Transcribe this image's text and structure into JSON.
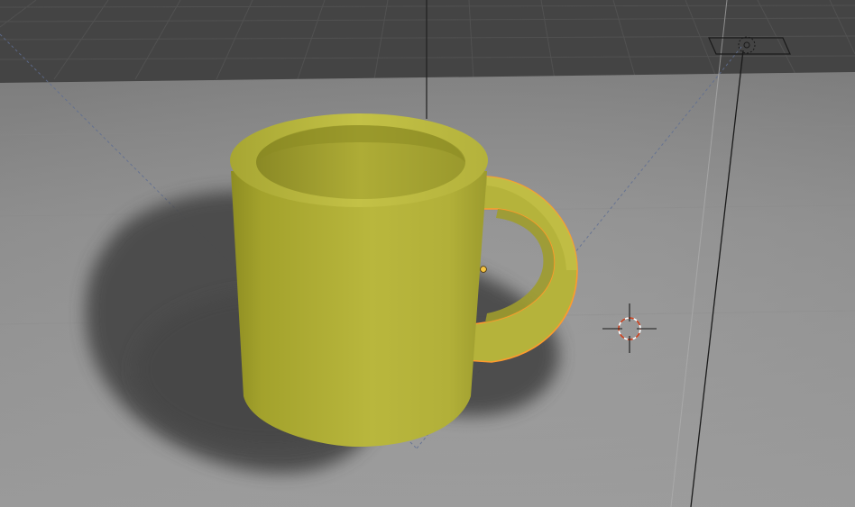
{
  "viewport": {
    "mode": "3D Viewport",
    "view": "perspective"
  },
  "scene": {
    "objects": [
      {
        "name_icon": "mug-body",
        "selected": false,
        "color": "#b5b43a"
      },
      {
        "name_icon": "mug-handle",
        "selected": true,
        "color": "#b8b63c",
        "outline_color": "#ff9a2e"
      }
    ],
    "cursor_icon": "3d-cursor-icon",
    "light_icon": "area-light-icon",
    "floor_color": "#8f8f8f",
    "background_color": "#424242"
  },
  "colors": {
    "grid_line": "#4e4e4e",
    "selection_outline": "#ff9a2e",
    "cursor_ring_a": "#ffffff",
    "cursor_ring_b": "#d0421e"
  }
}
